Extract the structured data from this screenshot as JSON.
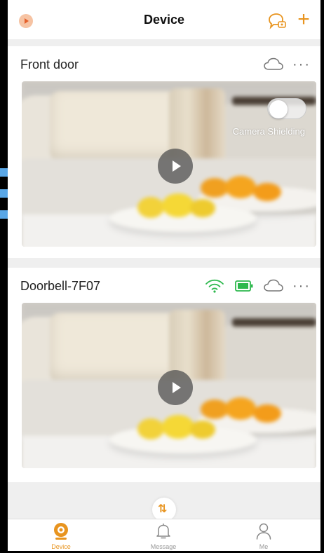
{
  "header": {
    "title": "Device",
    "logo_icon": "app-logo-icon",
    "message_icon": "chat-bubble-icon",
    "add_icon": "plus-icon",
    "add_label": "+",
    "accent_color": "#e8941f"
  },
  "devices": [
    {
      "name": "Front door",
      "icons": [
        "cloud-icon",
        "more-icon"
      ],
      "more_label": "···",
      "camera_shielding_label": "Camera Shielding",
      "camera_shielding_on": false
    },
    {
      "name": "Doorbell-7F07",
      "icons": [
        "wifi-icon",
        "battery-icon",
        "cloud-icon",
        "more-icon"
      ],
      "more_label": "···",
      "status_color": "#2db84d"
    }
  ],
  "swap_label": "⇅",
  "tabbar": {
    "tabs": [
      {
        "label": "Device",
        "icon": "camera-tab-icon",
        "active": true
      },
      {
        "label": "Message",
        "icon": "bell-icon",
        "active": false
      },
      {
        "label": "Me",
        "icon": "person-icon",
        "active": false
      }
    ]
  }
}
